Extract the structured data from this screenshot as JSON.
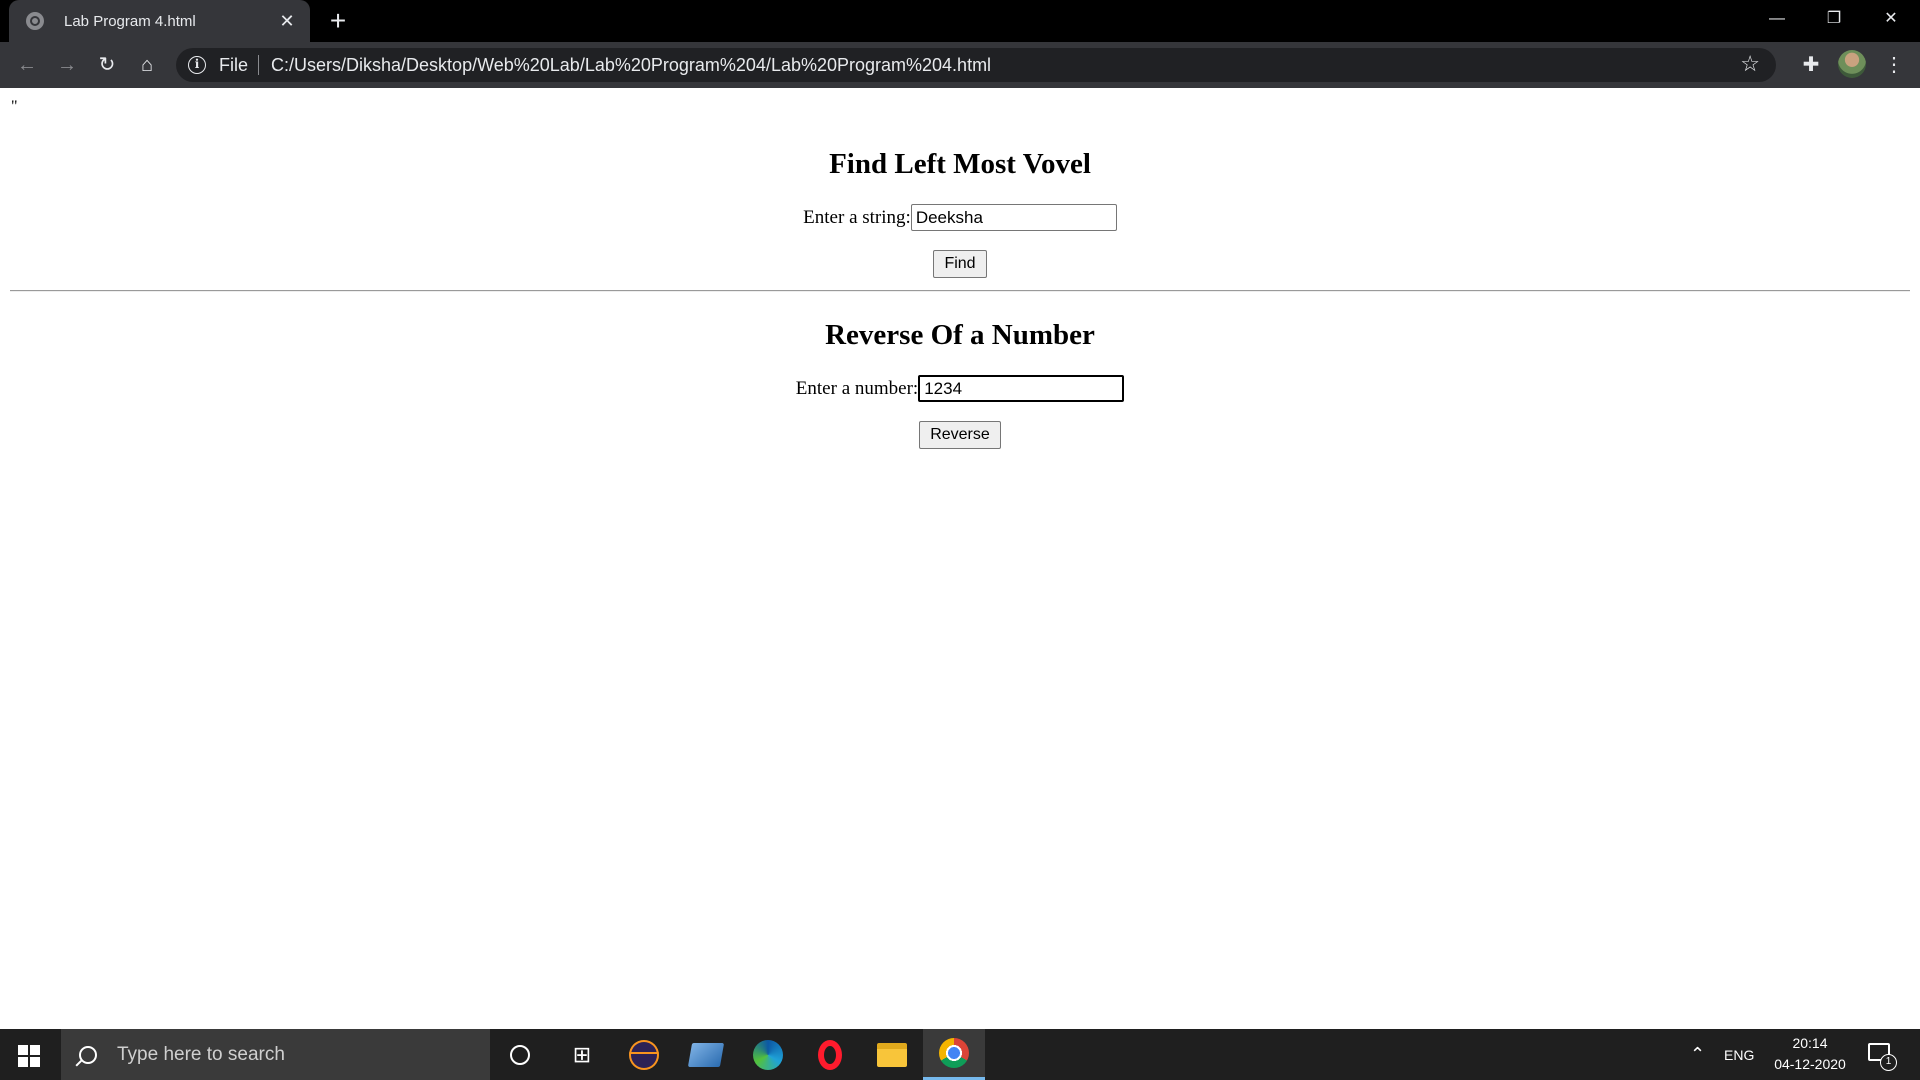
{
  "browser": {
    "tab_title": "Lab Program 4.html",
    "tab_close": "✕",
    "new_tab": "+",
    "window_controls": {
      "minimize": "—",
      "restore": "❐",
      "close": "✕"
    },
    "url_scheme": "File",
    "url": "C:/Users/Diksha/Desktop/Web%20Lab/Lab%20Program%204/Lab%20Program%204.html",
    "toolbar_icons": [
      "back-icon",
      "forward-icon",
      "reload-icon",
      "home-icon",
      "site-info-icon",
      "bookmark-star-icon",
      "extensions-icon",
      "profile-avatar",
      "menu-icon"
    ]
  },
  "page": {
    "stray_text": "\"",
    "vowel_section": {
      "heading": "Find Left Most Vovel",
      "label": "Enter a string:",
      "input_value": "Deeksha",
      "button_label": "Find"
    },
    "reverse_section": {
      "heading": "Reverse Of a Number",
      "label": "Enter a number:",
      "input_value": "1234",
      "button_label": "Reverse"
    }
  },
  "taskbar": {
    "search_placeholder": "Type here to search",
    "pinned_apps": [
      "cortana",
      "task-view",
      "eclipse",
      "laptop-app",
      "edge",
      "opera",
      "file-explorer",
      "chrome"
    ],
    "language": "ENG",
    "time": "20:14",
    "date": "04-12-2020",
    "notification_count": "1"
  },
  "colors": {
    "tab_strip": "#000000",
    "toolbar": "#35363a",
    "omnibox": "#202124",
    "taskbar": "#1f1f1f",
    "active_indicator": "#76b9ed"
  }
}
